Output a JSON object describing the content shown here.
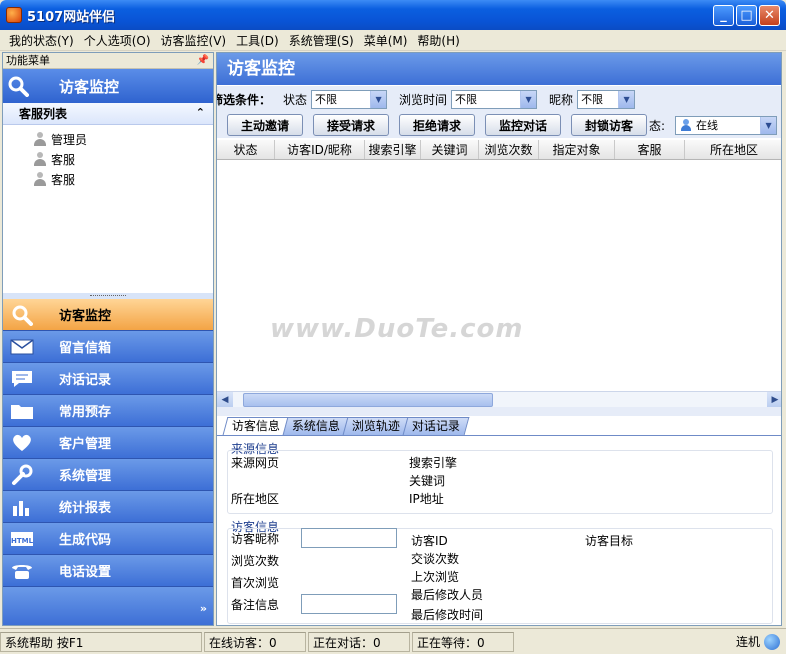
{
  "window": {
    "title": "5107网站伴侣",
    "buttons": {
      "minimize": "_",
      "maximize": "□",
      "close": "✕"
    }
  },
  "menu": [
    {
      "label": "我的状态(Y)"
    },
    {
      "label": "个人选项(O)"
    },
    {
      "label": "访客监控(V)"
    },
    {
      "label": "工具(D)"
    },
    {
      "label": "系统管理(S)"
    },
    {
      "label": "菜单(M)"
    },
    {
      "label": "帮助(H)"
    }
  ],
  "left_panel": {
    "header": "功能菜单",
    "banner": "访客监控",
    "service_list_title": "客服列表",
    "users": [
      {
        "name": "管理员"
      },
      {
        "name": "客服"
      },
      {
        "name": "客服"
      }
    ],
    "nav": [
      {
        "label": "访客监控",
        "icon": "search-icon",
        "active": true
      },
      {
        "label": "留言信箱",
        "icon": "mail-icon"
      },
      {
        "label": "对话记录",
        "icon": "chat-icon"
      },
      {
        "label": "常用预存",
        "icon": "folder-icon"
      },
      {
        "label": "客户管理",
        "icon": "heart-icon"
      },
      {
        "label": "系统管理",
        "icon": "wrench-icon"
      },
      {
        "label": "统计报表",
        "icon": "chart-icon"
      },
      {
        "label": "生成代码",
        "icon": "html-icon"
      },
      {
        "label": "电话设置",
        "icon": "phone-icon"
      }
    ],
    "expand_glyph": "»"
  },
  "right_panel": {
    "title": "访客监控",
    "filter": {
      "label": "筛选条件：",
      "status_label": "状态",
      "status_value": "不限",
      "browse_time_label": "浏览时间",
      "browse_time_value": "不限",
      "nickname_label": "昵称",
      "nickname_value": "不限"
    },
    "actions": [
      "主动邀请",
      "接受请求",
      "拒绝请求",
      "监控对话",
      "封锁访客"
    ],
    "state_label": "态:",
    "state_value": "在线",
    "columns": [
      "状态",
      "访客ID/昵称",
      "搜索引擎",
      "关键词",
      "浏览次数",
      "指定对象",
      "客服",
      "所在地区"
    ],
    "tabs": [
      "访客信息",
      "系统信息",
      "浏览轨迹",
      "对话记录"
    ],
    "source_info": {
      "title": "来源信息",
      "source_page": "来源网页",
      "search_engine": "搜索引擎",
      "keyword": "关键词",
      "region": "所在地区",
      "ip": "IP地址"
    },
    "visitor_info": {
      "title": "访客信息",
      "nickname": "访客昵称",
      "visitor_id": "访客ID",
      "visitor_goal": "访客目标",
      "browse_count": "浏览次数",
      "chat_count": "交谈次数",
      "first_browse": "首次浏览",
      "last_browse": "上次浏览",
      "note": "备注信息",
      "last_editor": "最后修改人员",
      "last_edit_time": "最后修改时间"
    }
  },
  "status_bar": {
    "help": "系统帮助 按F1",
    "online": "在线访客：0",
    "chatting": "正在对话：0",
    "waiting": "正在等待：0",
    "connection": "连机"
  },
  "watermark": "www.DuoTe.com"
}
